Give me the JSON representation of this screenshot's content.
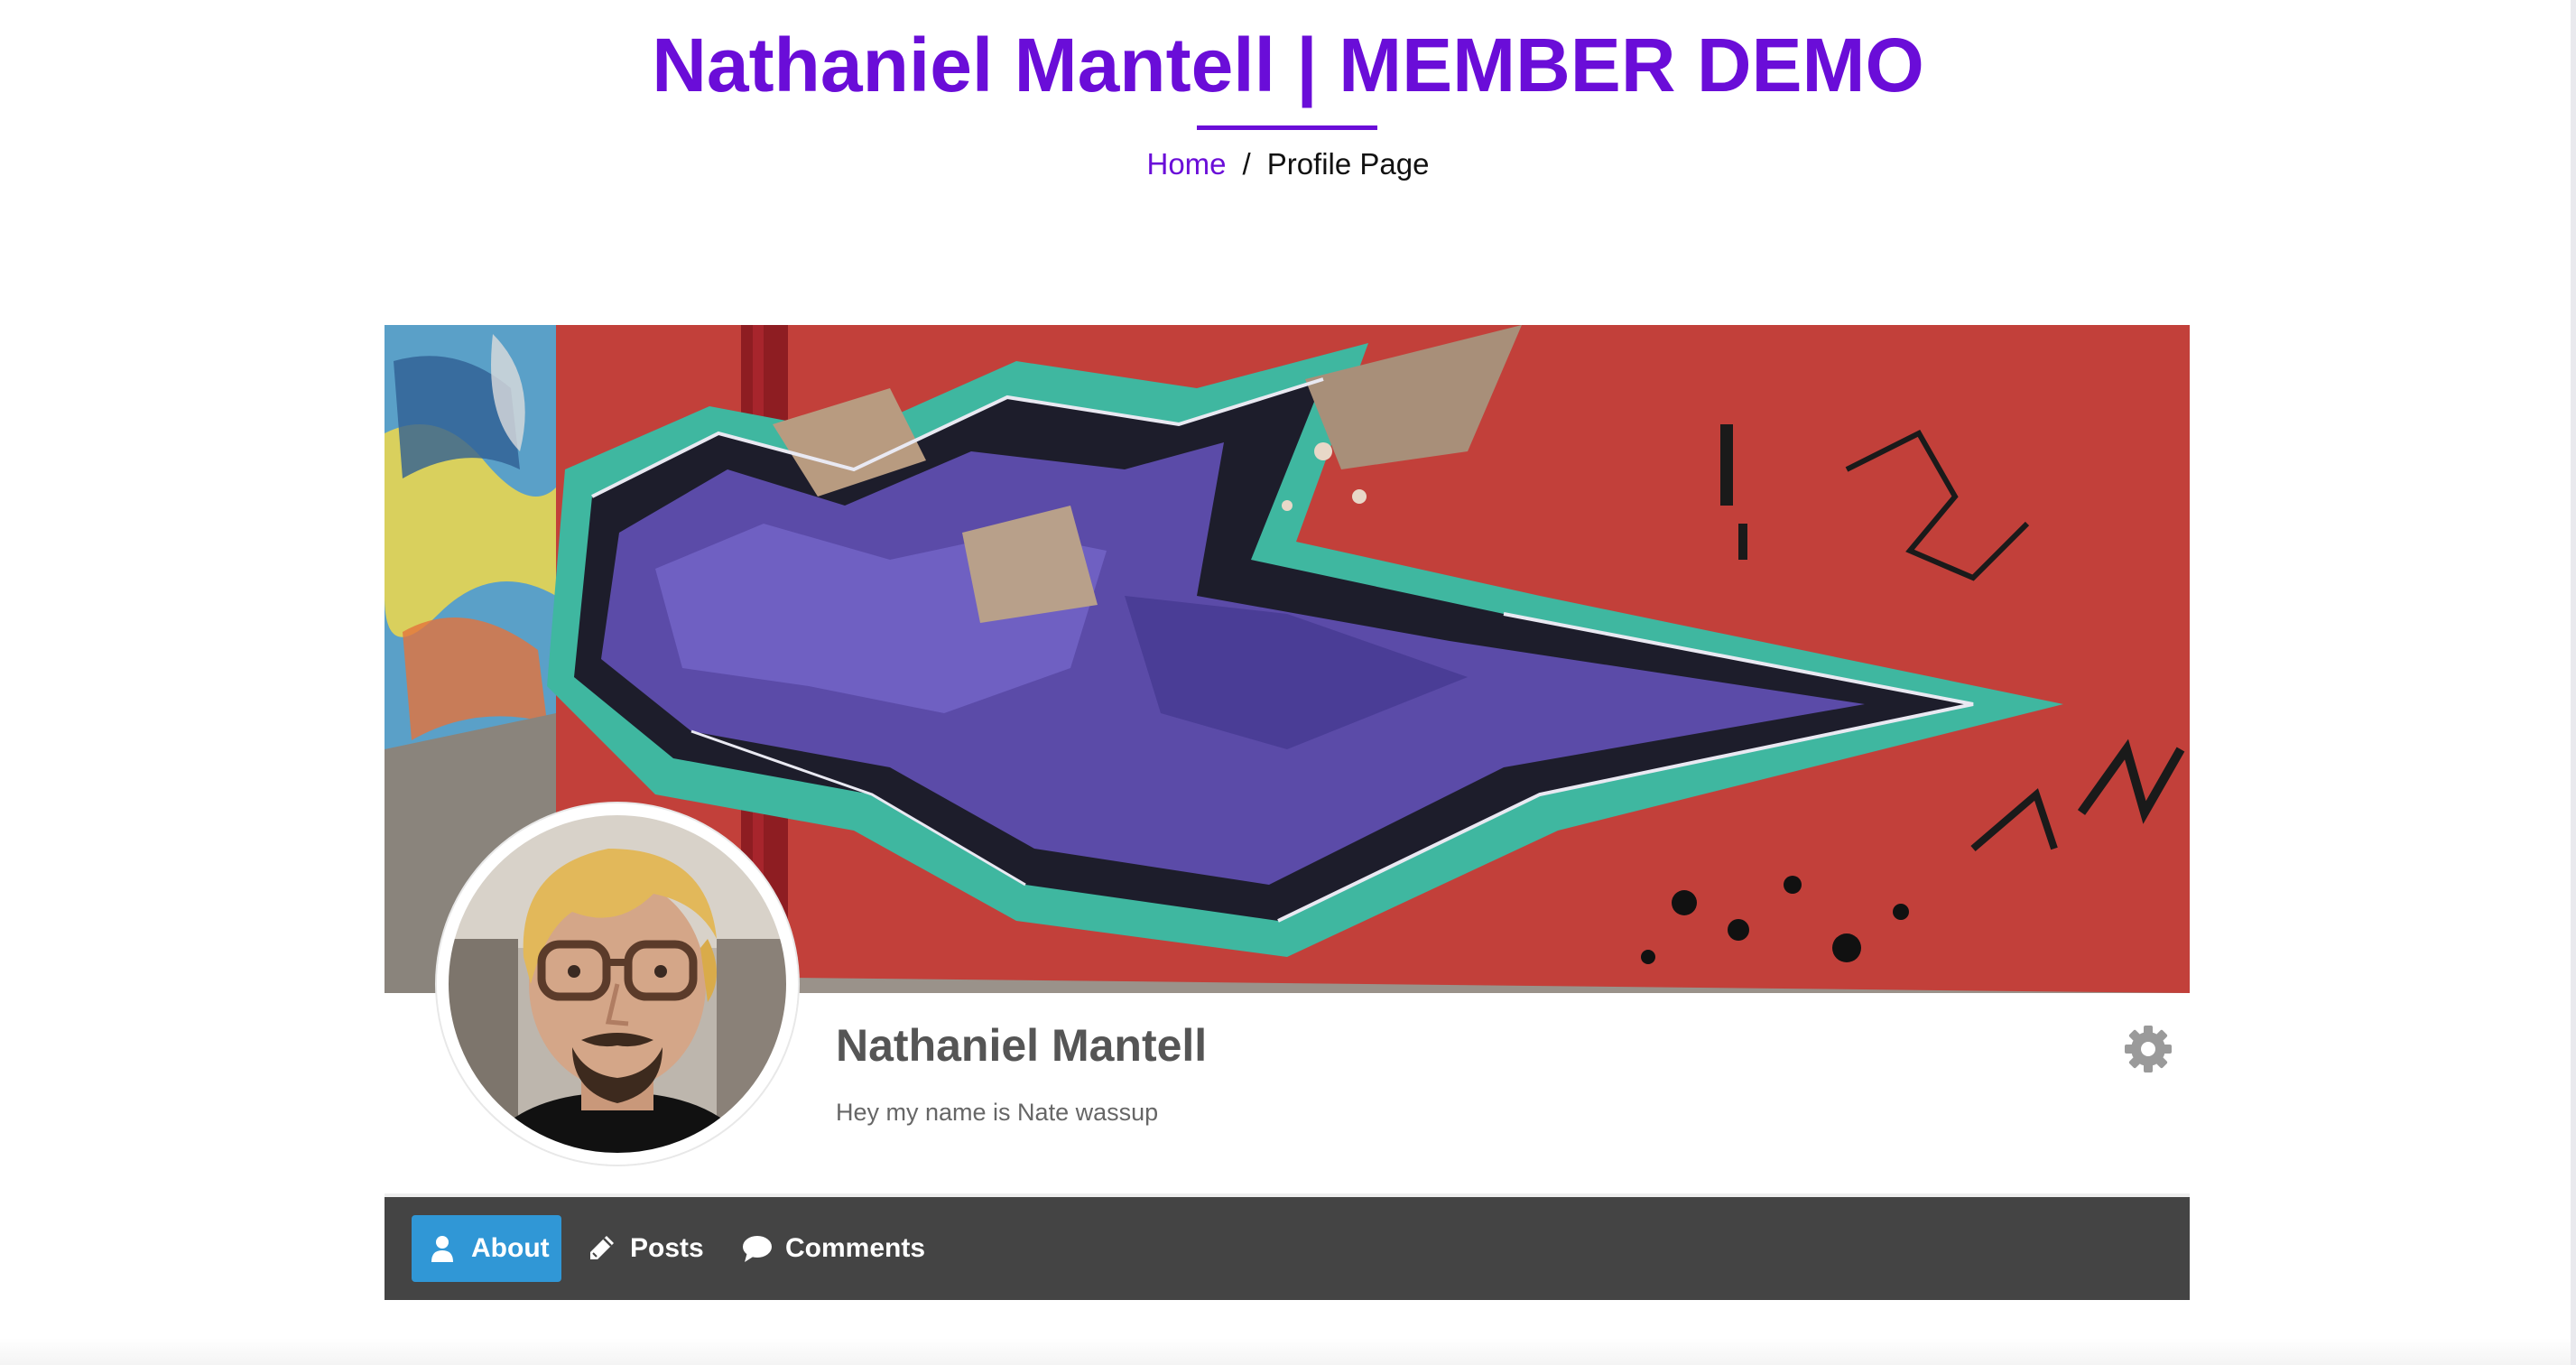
{
  "header": {
    "site_title": "Nathaniel Mantell | MEMBER DEMO",
    "accent_color": "#6a0dd8"
  },
  "breadcrumb": {
    "home": "Home",
    "separator": "/",
    "current": "Profile Page"
  },
  "profile": {
    "cover_image": "graffiti-mural",
    "avatar_image": "profile-photo",
    "name": "Nathaniel Mantell",
    "bio": "Hey my name is Nate wassup",
    "settings_icon": "gear-icon"
  },
  "nav": {
    "background": "#444444",
    "active_color": "#3097d6",
    "items": [
      {
        "label": "About",
        "icon": "user-icon",
        "active": true
      },
      {
        "label": "Posts",
        "icon": "pencil-icon",
        "active": false
      },
      {
        "label": "Comments",
        "icon": "comment-icon",
        "active": false
      }
    ]
  }
}
